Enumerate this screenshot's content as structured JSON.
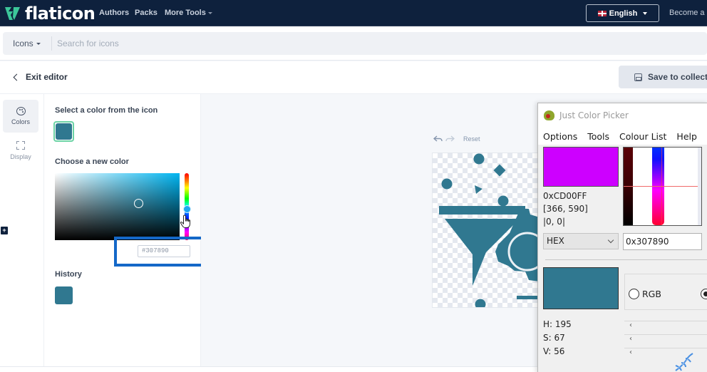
{
  "topnav": {
    "brand": "flaticon",
    "links": [
      "Authors",
      "Packs",
      "More Tools"
    ],
    "language": "English",
    "become_contributor": "Become a c"
  },
  "search": {
    "category": "Icons",
    "placeholder": "Search for icons",
    "value": ""
  },
  "editor": {
    "exit_label": "Exit editor",
    "save_label": "Save to collectio"
  },
  "rail": {
    "items": [
      {
        "label": "Colors",
        "icon": "palette-icon",
        "active": true
      },
      {
        "label": "Display",
        "icon": "expand-icon",
        "active": false
      }
    ],
    "plus_label": "+"
  },
  "color_panel": {
    "select_label": "Select a color from the icon",
    "selected_color": "#307890",
    "choose_label": "Choose a new color",
    "hex_value": "#307890",
    "history_label": "History",
    "history_colors": [
      "#307890"
    ],
    "highlight_color": "#1468c8"
  },
  "canvas": {
    "reset_label": "Reset",
    "icon_name": "funnel-gear-icon",
    "icon_color": "#307890"
  },
  "color_picker_app": {
    "title": "Just Color Picker",
    "menu": [
      "Options",
      "Tools",
      "Colour List",
      "Help"
    ],
    "current_color": "#CD00FF",
    "current_hex": "0xCD00FF",
    "cursor_position": "[366, 590]",
    "relative_position": "|0, 0|",
    "format": "HEX",
    "picked_hex": "0x307890",
    "picked_color": "#307890",
    "radio_options": [
      {
        "label": "RGB",
        "checked": false
      },
      {
        "label": "",
        "checked": true
      }
    ],
    "hsv": {
      "h": "H: 195",
      "s": "S: 67",
      "v": "V: 56"
    }
  }
}
